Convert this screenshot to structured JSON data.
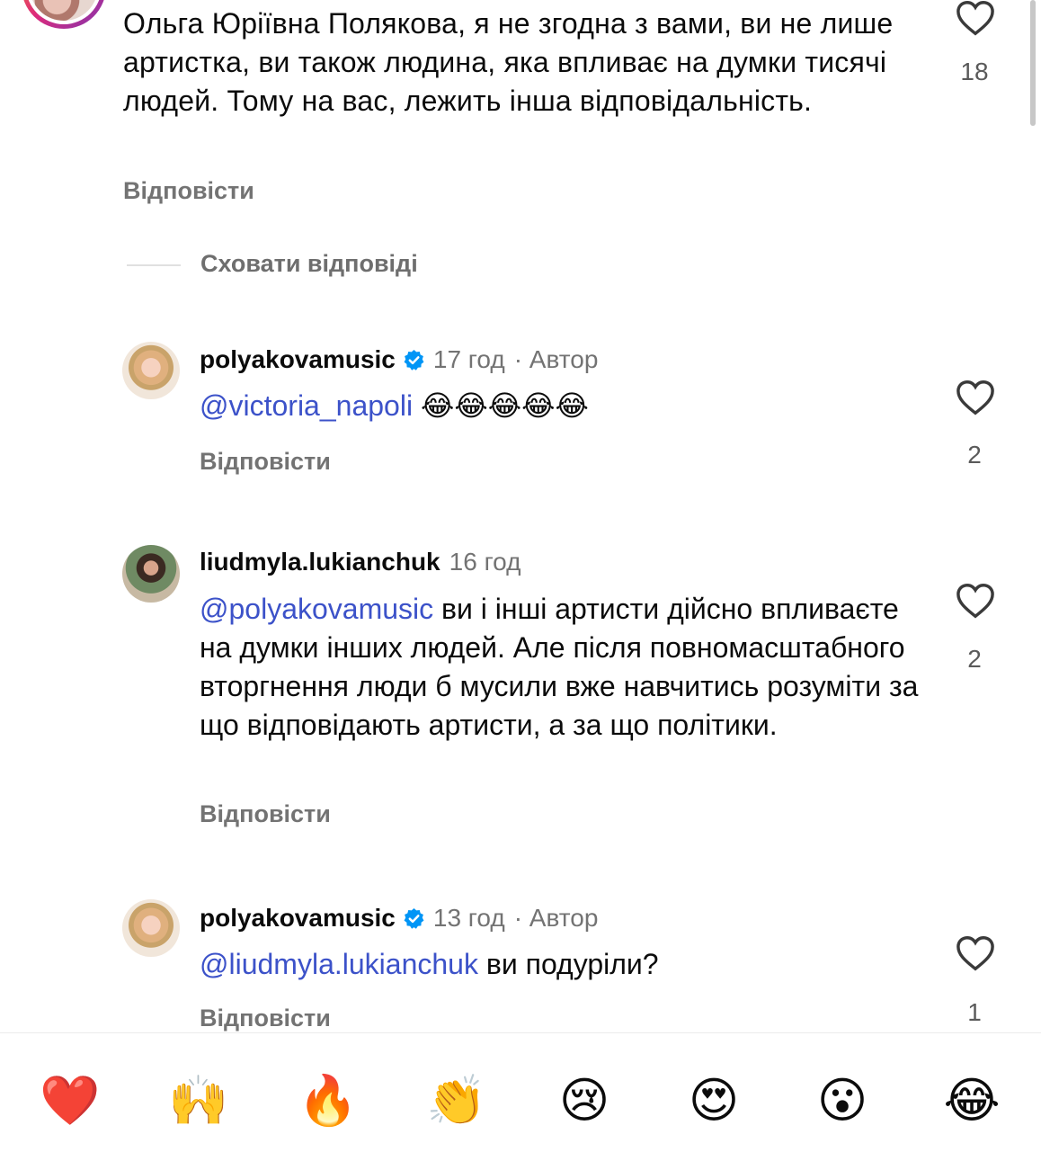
{
  "top_comment": {
    "text": "Ольга Юріївна Полякова, я не згодна з вами, ви не лише артистка, ви також людина, яка впливає на думки тисячі людей. Тому на вас, лежить інша відповідальність.",
    "reply_label": "Відповісти",
    "likes": "18"
  },
  "hide_replies_label": "Сховати відповіді",
  "replies": [
    {
      "username": "polyakovamusic",
      "verified": true,
      "time": "17 год",
      "author_tag": "· Автор",
      "mention": "@victoria_napoli",
      "text": " 😂😂😂😂😂",
      "reply_label": "Відповісти",
      "likes": "2"
    },
    {
      "username": "liudmyla.lukianchuk",
      "verified": false,
      "time": "16 год",
      "author_tag": "",
      "mention": "@polyakovamusic",
      "text": " ви і інші артисти дійсно впливаєте на думки інших людей. Але після повномасштабного вторгнення люди б мусили вже навчитись розуміти за що відповідають артисти,  а за що політики.",
      "reply_label": "Відповісти",
      "likes": "2"
    },
    {
      "username": "polyakovamusic",
      "verified": true,
      "time": "13 год",
      "author_tag": "· Автор",
      "mention": "@liudmyla.lukianchuk",
      "text": " ви подуріли?",
      "reply_label": "Відповісти",
      "likes": "1"
    }
  ],
  "reaction_bar": {
    "emojis": [
      "❤️",
      "🙌",
      "🔥",
      "👏",
      "😢",
      "😍",
      "😮",
      "😂"
    ]
  },
  "colors": {
    "mention": "#3c52c9",
    "secondary_text": "#737373",
    "verified_badge": "#0095f6"
  },
  "icons": {
    "like": "heart-outline-icon",
    "verified": "verified-badge-icon"
  }
}
